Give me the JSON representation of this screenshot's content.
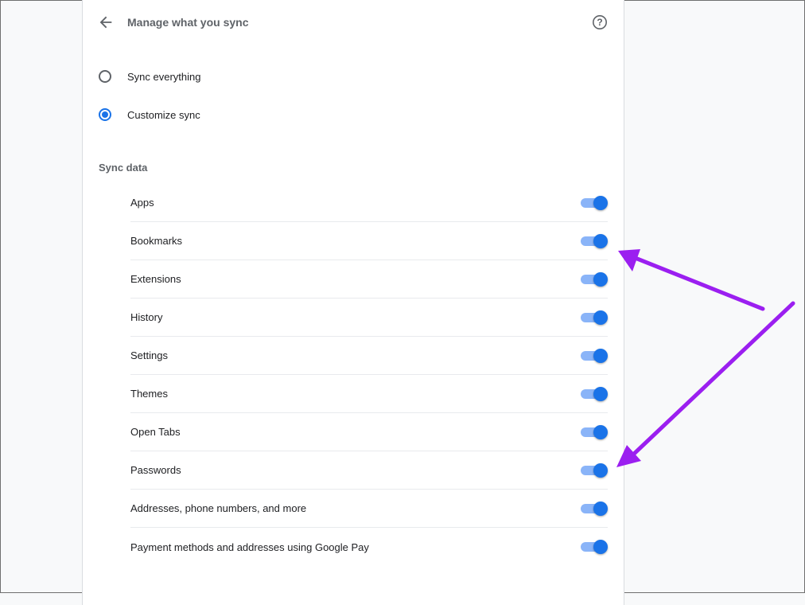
{
  "header": {
    "back_icon": "arrow-back-icon",
    "title": "Manage what you sync",
    "help_icon": "help-icon"
  },
  "sync_mode": {
    "options": [
      {
        "label": "Sync everything",
        "checked": false
      },
      {
        "label": "Customize sync",
        "checked": true
      }
    ]
  },
  "sync_data": {
    "title": "Sync data",
    "items": [
      {
        "label": "Apps",
        "enabled": true
      },
      {
        "label": "Bookmarks",
        "enabled": true
      },
      {
        "label": "Extensions",
        "enabled": true
      },
      {
        "label": "History",
        "enabled": true
      },
      {
        "label": "Settings",
        "enabled": true
      },
      {
        "label": "Themes",
        "enabled": true
      },
      {
        "label": "Open Tabs",
        "enabled": true
      },
      {
        "label": "Passwords",
        "enabled": true
      },
      {
        "label": "Addresses, phone numbers, and more",
        "enabled": true
      },
      {
        "label": "Payment methods and addresses using Google Pay",
        "enabled": true
      }
    ]
  },
  "colors": {
    "accent": "#1a73e8",
    "toggle_track": "#8ab4f8",
    "annotation_arrow": "#9b1ff0"
  }
}
